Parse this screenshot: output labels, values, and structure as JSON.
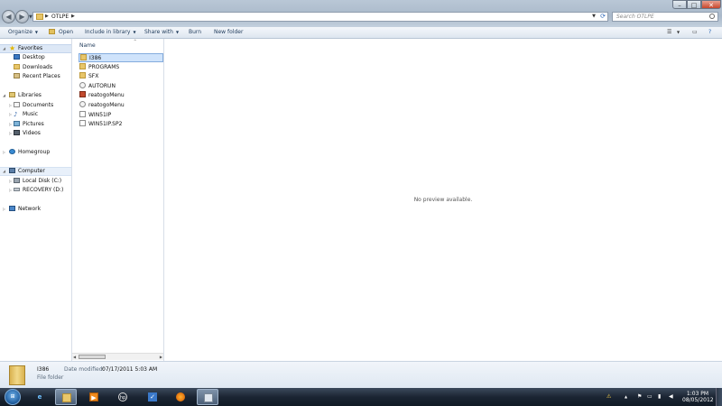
{
  "window": {
    "caption_min": "–",
    "caption_max": "□",
    "caption_close": "✕"
  },
  "address": {
    "path": "OTLPE",
    "search_placeholder": "Search OTLPE"
  },
  "toolbar": {
    "organize": "Organize",
    "open": "Open",
    "include_in_library": "Include in library",
    "share_with": "Share with",
    "burn": "Burn",
    "new_folder": "New folder"
  },
  "nav": {
    "favorites": "Favorites",
    "desktop": "Desktop",
    "downloads": "Downloads",
    "recent_places": "Recent Places",
    "libraries": "Libraries",
    "documents": "Documents",
    "music": "Music",
    "pictures": "Pictures",
    "videos": "Videos",
    "homegroup": "Homegroup",
    "computer": "Computer",
    "local_disk": "Local Disk (C:)",
    "recovery": "RECOVERY (D:)",
    "network": "Network"
  },
  "filelist": {
    "column_header": "Name",
    "items": [
      {
        "name": "I386",
        "icon": "folder-icon"
      },
      {
        "name": "PROGRAMS",
        "icon": "folder-icon"
      },
      {
        "name": "SFX",
        "icon": "folder-icon"
      },
      {
        "name": "AUTORUN",
        "icon": "settings-file-icon"
      },
      {
        "name": "reatogoMenu",
        "icon": "application-icon"
      },
      {
        "name": "reatogoMenu",
        "icon": "settings-file-icon"
      },
      {
        "name": "WIN51IP",
        "icon": "document-icon"
      },
      {
        "name": "WIN51IP.SP2",
        "icon": "document-icon"
      }
    ]
  },
  "preview": {
    "message": "No preview available."
  },
  "details": {
    "name": "I386",
    "date_modified_label": "Date modified:",
    "date_modified_value": "07/17/2011 5:03 AM",
    "type": "File folder"
  },
  "taskbar": {
    "time": "1:03 PM",
    "date": "08/05/2012"
  },
  "colors": {
    "selection": "#cfe3fb",
    "taskbar": "#1b2533",
    "folder": "#e8c66a"
  }
}
